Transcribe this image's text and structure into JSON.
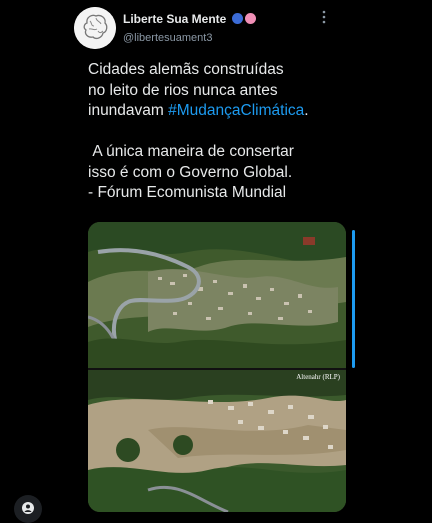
{
  "tweet": {
    "author_name": "Liberte Sua Mente",
    "author_handle": "@libertesuament3",
    "text_line1": "Cidades alemãs construídas",
    "text_line2": "no leito de rios nunca antes",
    "text_line3_prefix": "inundavam ",
    "hashtag": "#MudançaClimática",
    "text_line3_suffix": ".",
    "text_line4": "A única maneira de consertar",
    "text_line5": "isso é com o Governo Global.",
    "text_line6": "- Fórum Ecomunista Mundial"
  },
  "media": {
    "image2_caption": "Altenahr (RLP)"
  },
  "icons": {
    "more": "more-vertical-icon",
    "account": "account-icon",
    "emoji1": "speaking-head-icon",
    "emoji2": "brain-icon"
  },
  "colors": {
    "background": "#000000",
    "text": "#e7e9ea",
    "secondary": "#8b98a5",
    "accent": "#1d9bf0"
  }
}
